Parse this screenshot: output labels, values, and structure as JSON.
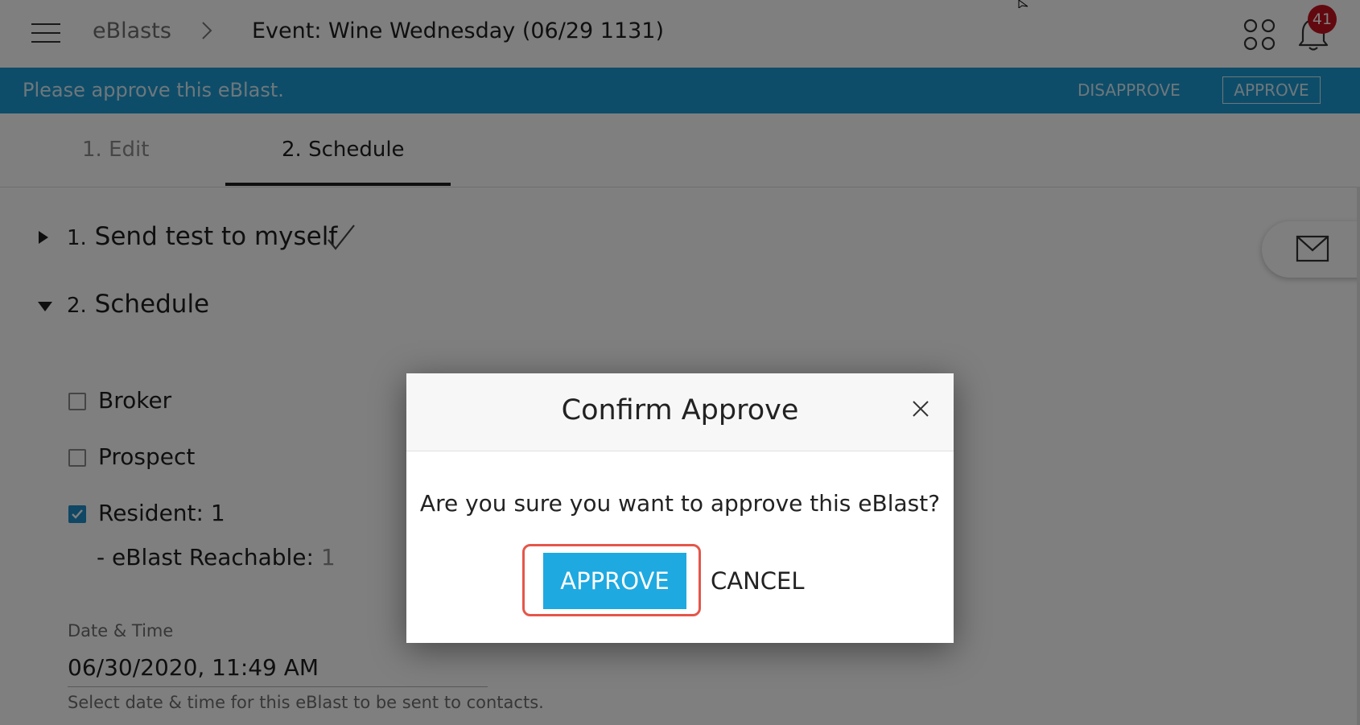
{
  "header": {
    "breadcrumb_root": "eBlasts",
    "breadcrumb_current": "Event: Wine Wednesday (06/29 1131)",
    "notification_count": "41",
    "badge_color": "#c5121e"
  },
  "approval_bar": {
    "message": "Please approve this eBlast.",
    "disapprove_label": "DISAPPROVE",
    "approve_label": "APPROVE",
    "bar_color": "#1c9ad2"
  },
  "tabs": [
    {
      "label": "1. Edit",
      "active": false
    },
    {
      "label": "2. Schedule",
      "active": true
    }
  ],
  "sections": {
    "send_test": {
      "number": "1.",
      "title": "Send test to myself",
      "completed": true,
      "expanded": false
    },
    "schedule": {
      "number": "2.",
      "title": "Schedule",
      "expanded": true
    }
  },
  "audience": [
    {
      "label": "Broker",
      "checked": false
    },
    {
      "label": "Prospect",
      "checked": false
    },
    {
      "label": "Resident: 1",
      "checked": true
    }
  ],
  "reachable": {
    "label": "- eBlast Reachable:",
    "value": "1"
  },
  "datetime": {
    "label": "Date & Time",
    "value": "06/30/2020, 11:49 AM",
    "hint": "Select date & time for this eBlast to be sent to contacts."
  },
  "modal": {
    "title": "Confirm Approve",
    "message": "Are you sure you want to approve this eBlast?",
    "approve_label": "APPROVE",
    "cancel_label": "CANCEL",
    "accent_color": "#1ea9e1",
    "focus_ring_color": "#e5564a"
  },
  "icons": {
    "menu": "hamburger-icon",
    "breadcrumb_separator": "chevron-right-icon",
    "apps": "apps-grid-icon",
    "notifications": "bell-icon",
    "expand_collapsed": "caret-right-icon",
    "expand_open": "caret-down-icon",
    "completed": "checkmark-icon",
    "mail": "mail-icon",
    "close": "close-icon",
    "pointer": "cursor-icon"
  }
}
